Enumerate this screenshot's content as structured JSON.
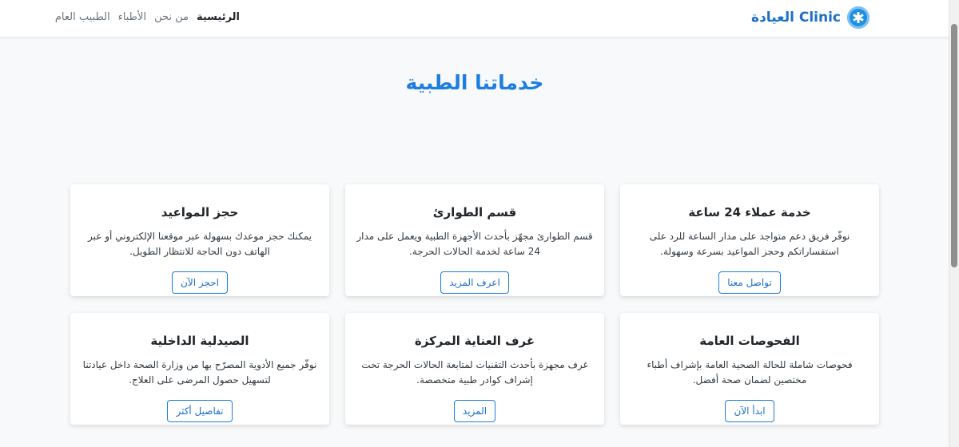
{
  "brand": {
    "name": "Clinic العيادة",
    "accent_color": "#1c7ee0",
    "logo_icon": "star-of-life-icon"
  },
  "nav": {
    "items": [
      {
        "label": "الرئيسية",
        "active": true
      },
      {
        "label": "من نحن",
        "active": false
      },
      {
        "label": "الأطباء",
        "active": false
      },
      {
        "label": "الطبيب العام",
        "active": false
      }
    ]
  },
  "main": {
    "title": "خدماتنا الطبية",
    "cards": [
      {
        "title": "خدمة عملاء 24 ساعة",
        "text": "نوفّر فريق دعم متواجد على مدار الساعة للرد على استفساراتكم وحجز المواعيد بسرعة وسهولة.",
        "button": "تواصل معنا"
      },
      {
        "title": "قسم الطوارئ",
        "text": "قسم الطوارئ مجهّز بأحدث الأجهزة الطبية ويعمل على مدار 24 ساعة لخدمة الحالات الحرجة.",
        "button": "اعرف المزيد"
      },
      {
        "title": "حجز المواعيد",
        "text": "يمكنك حجز موعدك بسهولة عبر موقعنا الإلكتروني أو عبر الهاتف دون الحاجة للانتظار الطويل.",
        "button": "احجز الآن"
      },
      {
        "title": "الفحوصات العامة",
        "text": "فحوصات شاملة للحالة الصحية العامة بإشراف أطباء مختصين لضمان صحة أفضل.",
        "button": "ابدأ الآن"
      },
      {
        "title": "غرف العناية المركزة",
        "text": "غرف مجهزة بأحدث التقنيات لمتابعة الحالات الحرجة تحت إشراف كوادر طبية متخصصة.",
        "button": "المزيد"
      },
      {
        "title": "الصيدلية الداخلية",
        "text": "نوفّر جميع الأدوية المصرّح بها من وزارة الصحة داخل عيادتنا لتسهيل حصول المرضى على العلاج.",
        "button": "تفاصيل أكثر"
      }
    ]
  }
}
